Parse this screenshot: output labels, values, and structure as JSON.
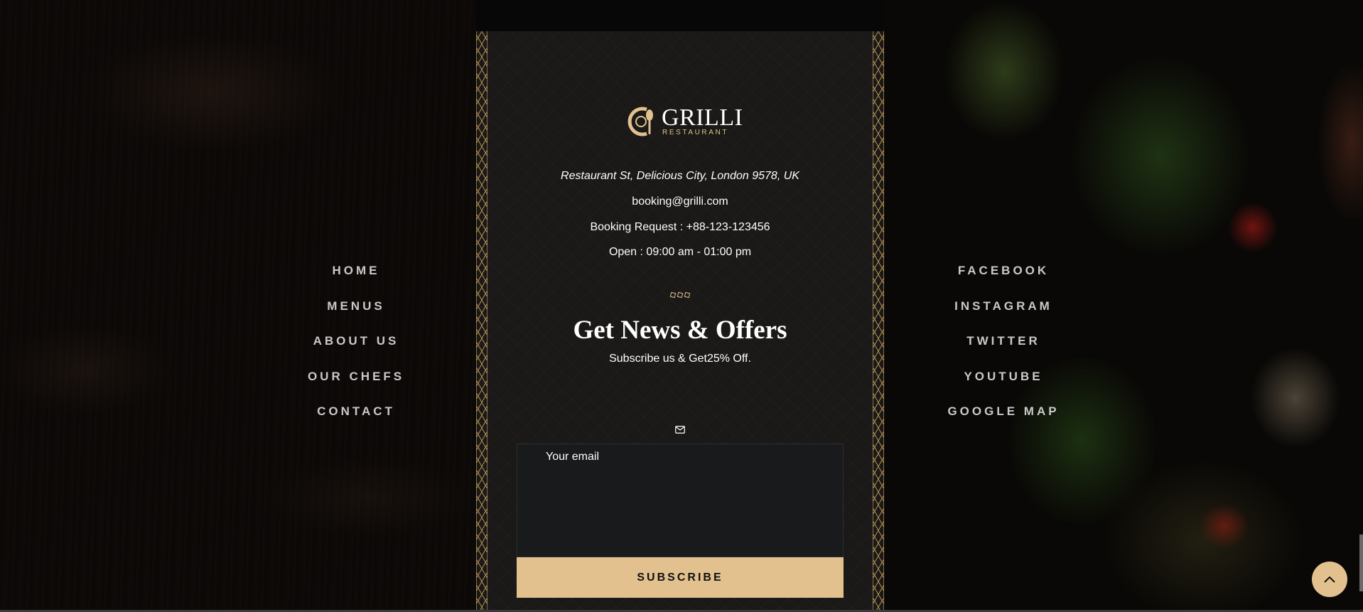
{
  "brand": {
    "name": "GRILLI",
    "tagline": "RESTAURANT",
    "accent": "#e2c18f"
  },
  "contact": {
    "address": "Restaurant St, Delicious City, London 9578, UK",
    "email": "booking@grilli.com",
    "phone": "Booking Request : +88-123-123456",
    "hours": "Open : 09:00 am - 01:00 pm"
  },
  "newsletter": {
    "title": "Get News & Offers",
    "subtitle": "Subscribe us & Get25% Off.",
    "email_placeholder": "Your email",
    "subscribe_label": "SUBSCRIBE"
  },
  "nav_left": [
    "HOME",
    "MENUS",
    "ABOUT US",
    "OUR CHEFS",
    "CONTACT"
  ],
  "nav_right": [
    "FACEBOOK",
    "INSTAGRAM",
    "TWITTER",
    "YOUTUBE",
    "GOOGLE MAP"
  ],
  "icons": {
    "mail": "mail-icon",
    "back_to_top": "chevron-up-icon",
    "divider": "diamond-divider"
  }
}
